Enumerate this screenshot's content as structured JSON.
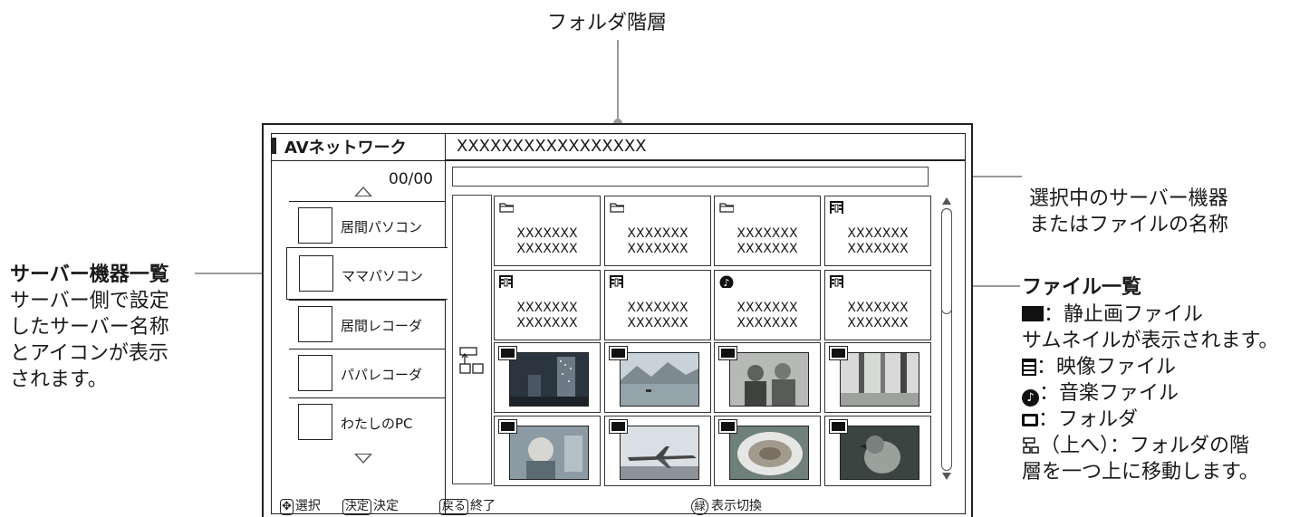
{
  "callouts": {
    "folder_hierarchy": "フォルダ階層",
    "selected_name_line1": "選択中のサーバー機器",
    "selected_name_line2": "またはファイルの名称",
    "server_list_title": "サーバー機器一覧",
    "server_list_desc": [
      "サーバー側で設定",
      "したサーバー名称",
      "とアイコンが表示",
      "されます。"
    ],
    "file_list_title": "ファイル一覧",
    "file_list_lines": [
      "：静止画ファイル",
      "サムネイルが表示されます。",
      "：映像ファイル",
      "：音楽ファイル",
      "：フォルダ",
      "（上へ）：フォルダの階",
      "層を一つ上に移動します。"
    ]
  },
  "screen": {
    "title": "AVネットワーク",
    "path": "XXXXXXXXXXXXXXXXX",
    "counter": "00/00",
    "servers": [
      {
        "label": "居間パソコン",
        "selected": false
      },
      {
        "label": "ママパソコン",
        "selected": true
      },
      {
        "label": "居間レコーダ",
        "selected": false
      },
      {
        "label": "パパレコーダ",
        "selected": false
      },
      {
        "label": "わたしのPC",
        "selected": false
      }
    ],
    "tiles": [
      {
        "type": "folder",
        "line1": "XXXXXXX",
        "line2": "XXXXXXX"
      },
      {
        "type": "folder",
        "line1": "XXXXXXX",
        "line2": "XXXXXXX"
      },
      {
        "type": "folder",
        "line1": "XXXXXXX",
        "line2": "XXXXXXX"
      },
      {
        "type": "video",
        "line1": "XXXXXXX",
        "line2": "XXXXXXX"
      },
      {
        "type": "video",
        "line1": "XXXXXXX",
        "line2": "XXXXXXX"
      },
      {
        "type": "video",
        "line1": "XXXXXXX",
        "line2": "XXXXXXX"
      },
      {
        "type": "music",
        "line1": "XXXXXXX",
        "line2": "XXXXXXX"
      },
      {
        "type": "video",
        "line1": "XXXXXXX",
        "line2": "XXXXXXX"
      },
      {
        "type": "photo",
        "scene": "city-night"
      },
      {
        "type": "photo",
        "scene": "lake-mountains"
      },
      {
        "type": "photo",
        "scene": "people"
      },
      {
        "type": "photo",
        "scene": "forest"
      },
      {
        "type": "photo",
        "scene": "child"
      },
      {
        "type": "photo",
        "scene": "airplane"
      },
      {
        "type": "photo",
        "scene": "food-plate"
      },
      {
        "type": "photo",
        "scene": "bird"
      }
    ],
    "footer": {
      "select_label": "選択",
      "enter_key": "決定",
      "enter_label": "決定",
      "back_key": "戻る",
      "back_label": "終了",
      "green_key": "緑",
      "green_label": "表示切換"
    }
  },
  "colors": {
    "frame": "#222222",
    "leader_line": "#9a9a9a"
  }
}
